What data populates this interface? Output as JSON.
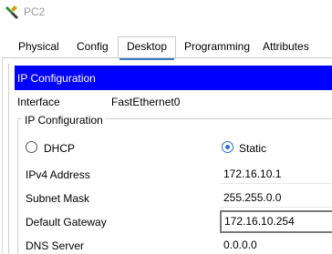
{
  "window": {
    "title": "PC2",
    "icon": "packet-tracer-pc-icon"
  },
  "tabs": [
    {
      "label": "Physical",
      "active": false
    },
    {
      "label": "Config",
      "active": false
    },
    {
      "label": "Desktop",
      "active": true
    },
    {
      "label": "Programming",
      "active": false
    },
    {
      "label": "Attributes",
      "active": false
    }
  ],
  "ip_config": {
    "header": "IP Configuration",
    "interface_label": "Interface",
    "interface_value": "FastEthernet0",
    "group_title": "IP Configuration",
    "mode_options": [
      {
        "label": "DHCP",
        "selected": false
      },
      {
        "label": "Static",
        "selected": true
      }
    ],
    "fields": [
      {
        "label": "IPv4 Address",
        "value": "172.16.10.1"
      },
      {
        "label": "Subnet Mask",
        "value": "255.255.0.0"
      },
      {
        "label": "Default Gateway",
        "value": "172.16.10.254",
        "focused": true
      },
      {
        "label": "DNS Server",
        "value": "0.0.0.0"
      }
    ]
  },
  "colors": {
    "header_bg": "#0000ff",
    "accent": "#2a6fd6",
    "title_text": "#999999"
  }
}
